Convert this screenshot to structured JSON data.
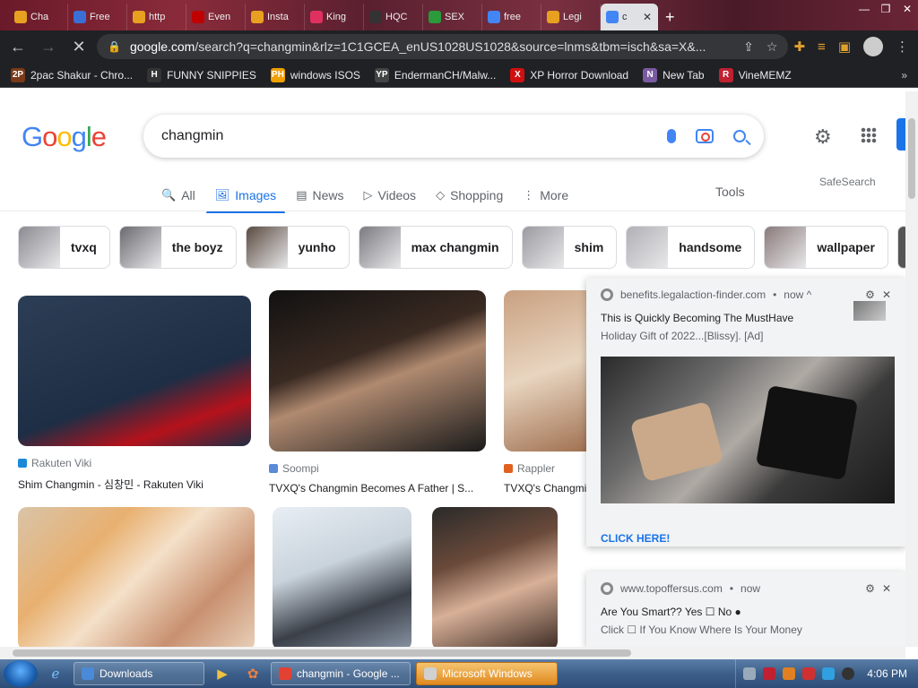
{
  "browser": {
    "tabs": [
      {
        "label": "Cha",
        "color": "#e8a020"
      },
      {
        "label": "Free",
        "color": "#3a6fd8"
      },
      {
        "label": "http",
        "color": "#e8a020"
      },
      {
        "label": "Even",
        "color": "#c00000"
      },
      {
        "label": "Insta",
        "color": "#e8a020"
      },
      {
        "label": "King",
        "color": "#e03060"
      },
      {
        "label": "HQC",
        "color": "#333333"
      },
      {
        "label": "SEX",
        "color": "#2a9a3a"
      },
      {
        "label": "free",
        "color": "#4285f4"
      },
      {
        "label": "Legi",
        "color": "#e8a020"
      }
    ],
    "active_tab": {
      "label": "c"
    },
    "url_host": "google.com",
    "url_rest": "/search?q=changmin&rlz=1C1GCEA_enUS1028US1028&source=lnms&tbm=isch&sa=X&..."
  },
  "bookmarks": [
    {
      "label": "2pac Shakur - Chro...",
      "icon": "2P",
      "color": "#7a3a1a"
    },
    {
      "label": "FUNNY SNIPPIES",
      "icon": "H",
      "color": "#333333"
    },
    {
      "label": "windows ISOS",
      "icon": "PH",
      "color": "#f0a000"
    },
    {
      "label": "EndermanCH/Malw...",
      "icon": "YP",
      "color": "#444444"
    },
    {
      "label": "XP Horror Download",
      "icon": "X",
      "color": "#d01010"
    },
    {
      "label": "New Tab",
      "icon": "N",
      "color": "#7a5aa0"
    },
    {
      "label": "VineMEMZ",
      "icon": "R",
      "color": "#c02030"
    }
  ],
  "google": {
    "logo": [
      "G",
      "o",
      "o",
      "g",
      "l",
      "e"
    ],
    "query": "changmin",
    "tabs": [
      {
        "label": "All",
        "icon": "🔍"
      },
      {
        "label": "Images",
        "icon": "🖼"
      },
      {
        "label": "News",
        "icon": "▤"
      },
      {
        "label": "Videos",
        "icon": "▷"
      },
      {
        "label": "Shopping",
        "icon": "◇"
      },
      {
        "label": "More",
        "icon": "⋮"
      }
    ],
    "active_tab": "Images",
    "tools_label": "Tools",
    "safesearch_label": "SafeSearch",
    "chips": [
      {
        "label": "tvxq",
        "color": "#8a8a90"
      },
      {
        "label": "the boyz",
        "color": "#6a6a70"
      },
      {
        "label": "yunho",
        "color": "#5a4a40"
      },
      {
        "label": "max changmin",
        "color": "#7a7a80"
      },
      {
        "label": "shim",
        "color": "#9a9aa0"
      },
      {
        "label": "handsome",
        "color": "#b0b0b5"
      },
      {
        "label": "wallpaper",
        "color": "#8a7a7a"
      }
    ],
    "results": [
      {
        "source": "Rakuten Viki",
        "title": "Shim Changmin - 심창민 - Rakuten Viki",
        "src_color": "#1a8ad8",
        "bg": "linear-gradient(160deg,#2c3e55 0%,#1e2e45 60%,#b5121b 80%,#1e2e45 100%)"
      },
      {
        "source": "Soompi",
        "title": "TVXQ's Changmin Becomes A Father | S...",
        "src_color": "#5a8ad8",
        "bg": "linear-gradient(160deg,#111 0%,#3a2a22 40%,#b08a70 55%,#1a1a1a 100%)"
      },
      {
        "source": "Rappler",
        "title": "TVXQ's Changmi",
        "src_color": "#e06020",
        "bg": "linear-gradient(160deg,#c9a080 0%,#e8d5c0 50%,#a07050 100%)"
      }
    ]
  },
  "notifications": [
    {
      "origin": "benefits.legalaction-finder.com",
      "time": "now ^",
      "title": "This is Quickly Becoming The MustHave",
      "subtitle": "Holiday Gift of 2022...[Blissy].    [Ad]",
      "cta": "CLICK HERE!"
    },
    {
      "origin": "www.topoffersus.com",
      "time": "now",
      "title": "Are You Smart?? Yes ☐ No ●",
      "subtitle": "Click ☐ If You Know Where Is Your Money"
    }
  ],
  "taskbar": {
    "buttons": [
      {
        "label": "Downloads",
        "color": "#4a8ad8"
      },
      {
        "label": "changmin - Google ...",
        "color": "#e34133"
      },
      {
        "label": "Microsoft Windows",
        "color": "#d0d0d0"
      }
    ],
    "clock": "4:06 PM"
  }
}
